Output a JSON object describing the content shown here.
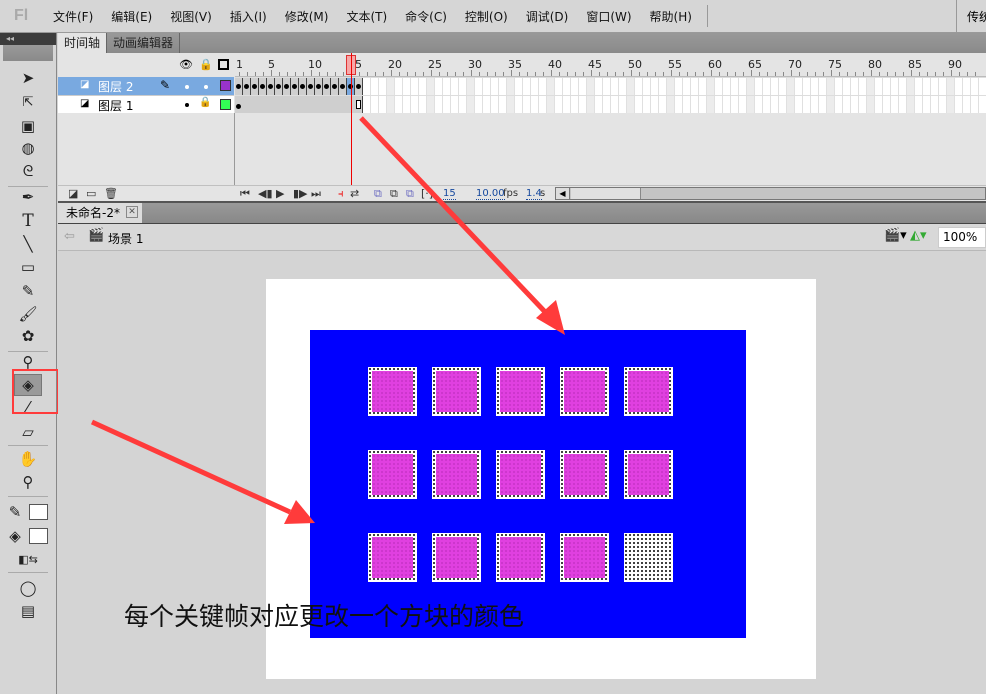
{
  "app": {
    "logo": "Fl"
  },
  "menu": [
    "文件(F)",
    "编辑(E)",
    "视图(V)",
    "插入(I)",
    "修改(M)",
    "文本(T)",
    "命令(C)",
    "控制(O)",
    "调试(D)",
    "窗口(W)",
    "帮助(H)"
  ],
  "workspace": "传统",
  "panel_tabs": [
    "时间轴",
    "动画编辑器"
  ],
  "timeline": {
    "ruler": [
      "1",
      "5",
      "10",
      "15",
      "20",
      "25",
      "30",
      "35",
      "40",
      "45",
      "50",
      "55",
      "60",
      "65",
      "70",
      "75",
      "80",
      "85",
      "90"
    ],
    "current_frame": 15,
    "layers": [
      {
        "name": "图层 2",
        "color": "#9933cc",
        "selected": true,
        "keyframes": 16
      },
      {
        "name": "图层 1",
        "color": "#33ff55",
        "selected": false,
        "keyframes": 1
      }
    ],
    "status": {
      "frame": "15",
      "fps": "10.00",
      "fps_unit": "fps",
      "time": "1.4",
      "time_unit": "s"
    }
  },
  "document": {
    "tab": "未命名-2*",
    "scene": "场景 1",
    "zoom": "100%"
  },
  "stage": {
    "background": "#ffffff",
    "rect_color": "#0000ff",
    "square_color": "#e040e0",
    "grid_rows": 3,
    "grid_cols": 5,
    "unfilled_squares": [
      14
    ]
  },
  "annotation": {
    "caption": "每个关键帧对应更改一个方块的颜色",
    "arrow_color": "#ff3b3b"
  }
}
